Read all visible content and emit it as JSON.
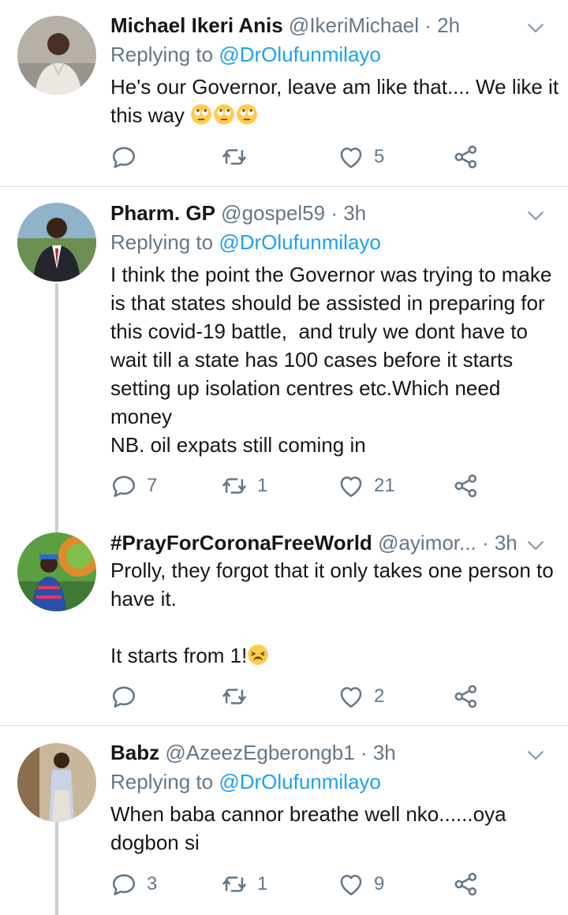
{
  "tweets": [
    {
      "name": "Michael Ikeri Anis",
      "handle": "@IkeriMichael",
      "sep": " · ",
      "time": "2h",
      "replying_prefix": "Replying to ",
      "replying_to": "@DrOlufunmilayo",
      "text": "He's our Governor, leave am like that.... We like it this way",
      "emoji": [
        "face-with-rolling-eyes",
        "face-with-rolling-eyes",
        "face-with-rolling-eyes"
      ],
      "reply_count": "",
      "retweet_count": "",
      "like_count": "5"
    },
    {
      "name": "Pharm. GP",
      "handle": "@gospel59",
      "sep": " · ",
      "time": "3h",
      "replying_prefix": "Replying to ",
      "replying_to": "@DrOlufunmilayo",
      "text": "I think the point the Governor was trying to make is that states should be assisted in preparing for this covid-19 battle,  and truly we dont have to wait till a state has 100 cases before it starts setting up isolation centres etc.Which need money\nNB. oil expats still coming in",
      "reply_count": "7",
      "retweet_count": "1",
      "like_count": "21"
    },
    {
      "name": "#PrayForCoronaFreeWorld",
      "handle": "@ayimor...",
      "sep": " · ",
      "time": "3h",
      "text": "Prolly, they forgot that it only takes one person to have it.\n\nIt starts from 1!",
      "emoji": [
        "weary-face"
      ],
      "reply_count": "",
      "retweet_count": "",
      "like_count": "2"
    },
    {
      "name": "Babz",
      "handle": "@AzeezEgberongb1",
      "sep": " · ",
      "time": "3h",
      "replying_prefix": "Replying to ",
      "replying_to": "@DrOlufunmilayo",
      "text": "When baba cannor breathe well nko......oya dogbon si",
      "reply_count": "3",
      "retweet_count": "1",
      "like_count": "9"
    }
  ],
  "icons": {
    "reply": "reply-icon",
    "retweet": "retweet-icon",
    "like": "heart-icon",
    "share": "share-icon",
    "more": "chevron-down-icon"
  },
  "colors": {
    "text": "#14171a",
    "secondary": "#657786",
    "link": "#1da1f2",
    "divider": "#d8dee3"
  }
}
